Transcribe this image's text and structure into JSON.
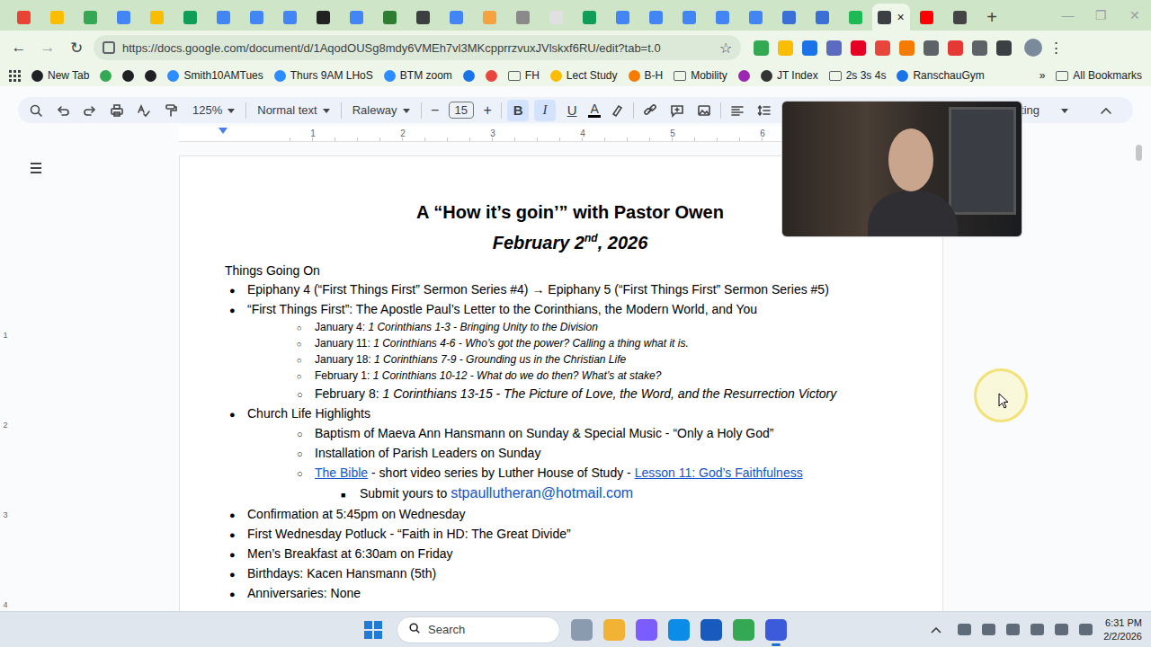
{
  "tab_strip": {
    "tabs": [
      {
        "color": "#ea4335",
        "selected": false
      },
      {
        "color": "#fbbc04",
        "selected": false
      },
      {
        "color": "#34a853",
        "selected": false
      },
      {
        "color": "#4285f4",
        "selected": false
      },
      {
        "color": "#fbbc04",
        "selected": false
      },
      {
        "color": "#0f9d58",
        "selected": false
      },
      {
        "color": "#4285f4",
        "selected": false
      },
      {
        "color": "#4285f4",
        "selected": false
      },
      {
        "color": "#4285f4",
        "selected": false
      },
      {
        "color": "#222222",
        "selected": false
      },
      {
        "color": "#4285f4",
        "selected": false
      },
      {
        "color": "#2e7d32",
        "selected": false
      },
      {
        "color": "#3c4043",
        "selected": false
      },
      {
        "color": "#4285f4",
        "selected": false
      },
      {
        "color": "#f4a340",
        "selected": false
      },
      {
        "color": "#8a8a8a",
        "selected": false
      },
      {
        "color": "#e0e0e0",
        "selected": false
      },
      {
        "color": "#0f9d58",
        "selected": false
      },
      {
        "color": "#4285f4",
        "selected": false
      },
      {
        "color": "#4285f4",
        "selected": false
      },
      {
        "color": "#4285f4",
        "selected": false
      },
      {
        "color": "#4285f4",
        "selected": false
      },
      {
        "color": "#4285f4",
        "selected": false
      },
      {
        "color": "#3b6fd8",
        "selected": false
      },
      {
        "color": "#3b6fd8",
        "selected": false
      },
      {
        "color": "#1db954",
        "selected": false
      },
      {
        "color": "#3c4043",
        "selected": true
      },
      {
        "color": "#ff0000",
        "selected": false
      },
      {
        "color": "#444444",
        "selected": false
      }
    ],
    "close_glyph": "×",
    "new_tab": "+",
    "window_controls": [
      "—",
      "❐",
      "✕"
    ]
  },
  "toolbar": {
    "back": "←",
    "forward": "→",
    "reload": "↻",
    "url": "https://docs.google.com/document/d/1AqodOUSg8mdy6VMEh7vl3MKcpprrzvuxJVlskxf6RU/edit?tab=t.0",
    "star": "☆",
    "menu": "⋮",
    "extensions": [
      {
        "color": "#34a853"
      },
      {
        "color": "#fbbc04"
      },
      {
        "color": "#1a73e8"
      },
      {
        "color": "#5c6bc0"
      },
      {
        "color": "#e60023"
      },
      {
        "color": "#e8453c"
      },
      {
        "color": "#f57c00"
      },
      {
        "color": "#5f6368"
      },
      {
        "color": "#e53935"
      },
      {
        "color": "#5f6368"
      },
      {
        "color": "#3c4043"
      }
    ]
  },
  "bookmarks": {
    "items": [
      {
        "label": "New Tab",
        "kind": "site",
        "color": "#202124"
      },
      {
        "kind": "site",
        "color": "#34a853"
      },
      {
        "kind": "site",
        "color": "#202124"
      },
      {
        "kind": "site",
        "color": "#202124"
      },
      {
        "label": "Smith10AMTues",
        "kind": "site",
        "color": "#2d8cff"
      },
      {
        "label": "Thurs 9AM LHoS",
        "kind": "site",
        "color": "#2d8cff"
      },
      {
        "label": "BTM zoom",
        "kind": "site",
        "color": "#2d8cff"
      },
      {
        "kind": "site",
        "color": "#1a73e8"
      },
      {
        "kind": "site",
        "color": "#e8453c"
      },
      {
        "label": "FH",
        "kind": "folder",
        "color": "#5f6368"
      },
      {
        "label": "Lect Study",
        "kind": "site",
        "color": "#fbbc04"
      },
      {
        "label": "B-H",
        "kind": "site",
        "color": "#f57c00"
      },
      {
        "label": "Mobility",
        "kind": "folder",
        "color": "#5f6368"
      },
      {
        "kind": "site",
        "color": "#9c27b0"
      },
      {
        "label": "JT Index",
        "kind": "site",
        "color": "#333333"
      },
      {
        "label": "2s 3s 4s",
        "kind": "folder",
        "color": "#5f6368"
      },
      {
        "label": "RanschauGym",
        "kind": "site",
        "color": "#1a73e8"
      }
    ],
    "more": "»",
    "all": "All Bookmarks"
  },
  "docs_toolbar": {
    "zoom": "125%",
    "style": "Normal text",
    "font": "Raleway",
    "minus": "−",
    "size": "15",
    "plus": "+",
    "format": [
      {
        "label": "B",
        "selected": true
      },
      {
        "label": "I",
        "selected": true
      },
      {
        "label": "U",
        "selected": false
      }
    ],
    "text_color": "A",
    "mode": "diting"
  },
  "ruler": [
    "1",
    "2",
    "3",
    "4",
    "5",
    "6"
  ],
  "vertical_ruler": [
    "1",
    "2",
    "3",
    "4"
  ],
  "document": {
    "title": "A “How it’s goin’” with Pastor Owen",
    "date": {
      "main": "February 2",
      "sup": "nd",
      "rest": ", 2026"
    },
    "section": "Things Going On",
    "items": [
      {
        "level": 1,
        "size": "normal",
        "bullet": "●",
        "segments": [
          {
            "text": "Epiphany 4 (“First Things First” Sermon Series #4) → Epiphany 5 (“First Things First” Sermon Series #5)",
            "kind": "plain"
          }
        ]
      },
      {
        "level": 1,
        "size": "normal",
        "bullet": "●",
        "segments": [
          {
            "text": "“First Things First”: The Apostle Paul’s Letter to the Corinthians, the Modern World, and You",
            "kind": "plain"
          }
        ]
      },
      {
        "level": 2,
        "size": "small",
        "bullet": "○",
        "segments": [
          {
            "text": "January 4: ",
            "kind": "plain"
          },
          {
            "text": "1 Corinthians 1-3 - Bringing Unity to the Division",
            "kind": "italic"
          }
        ]
      },
      {
        "level": 2,
        "size": "small",
        "bullet": "○",
        "segments": [
          {
            "text": "January 11: ",
            "kind": "plain"
          },
          {
            "text": "1 Corinthians 4-6 - Who’s got the power? Calling a thing what it is.",
            "kind": "italic"
          }
        ]
      },
      {
        "level": 2,
        "size": "small",
        "bullet": "○",
        "segments": [
          {
            "text": "January 18: ",
            "kind": "plain"
          },
          {
            "text": "1 Corinthians 7-9 - Grounding us in the Christian Life",
            "kind": "italic"
          }
        ]
      },
      {
        "level": 2,
        "size": "small",
        "bullet": "○",
        "segments": [
          {
            "text": "February 1: ",
            "kind": "plain"
          },
          {
            "text": "1 Corinthians 10-12 - What do we do then? What’s at stake?",
            "kind": "italic"
          }
        ]
      },
      {
        "level": 2,
        "size": "normal",
        "bullet": "○",
        "segments": [
          {
            "text": "February 8: ",
            "kind": "plain"
          },
          {
            "text": "1 Corinthians 13-15 - The Picture of Love, the Word, and the Resurrection Victory",
            "kind": "italic"
          }
        ]
      },
      {
        "level": 1,
        "size": "normal",
        "bullet": "●",
        "segments": [
          {
            "text": "Church Life Highlights",
            "kind": "plain"
          }
        ]
      },
      {
        "level": 2,
        "size": "normal",
        "bullet": "○",
        "segments": [
          {
            "text": "Baptism of Maeva Ann Hansmann on Sunday & Special Music - “Only a Holy God”",
            "kind": "plain"
          }
        ]
      },
      {
        "level": 2,
        "size": "normal",
        "bullet": "○",
        "segments": [
          {
            "text": "Installation of Parish Leaders on Sunday",
            "kind": "plain"
          }
        ]
      },
      {
        "level": 2,
        "size": "normal",
        "bullet": "○",
        "segments": [
          {
            "text": "The Bible",
            "kind": "link"
          },
          {
            "text": " - short video series by Luther House of Study - ",
            "kind": "plain"
          },
          {
            "text": "Lesson 11: God’s Faithfulness",
            "kind": "link"
          }
        ]
      },
      {
        "level": 3,
        "size": "normal",
        "bullet": "■",
        "segments": [
          {
            "text": "Submit yours to ",
            "kind": "plain"
          },
          {
            "text": "stpaullutheran@hotmail.com",
            "kind": "email"
          }
        ]
      },
      {
        "level": 1,
        "size": "normal",
        "bullet": "●",
        "segments": [
          {
            "text": "Confirmation at 5:45pm on Wednesday",
            "kind": "plain"
          }
        ]
      },
      {
        "level": 1,
        "size": "normal",
        "bullet": "●",
        "segments": [
          {
            "text": "First Wednesday Potluck - “Faith in HD: The Great Divide”",
            "kind": "plain"
          }
        ]
      },
      {
        "level": 1,
        "size": "normal",
        "bullet": "●",
        "segments": [
          {
            "text": "Men’s Breakfast at 6:30am on Friday",
            "kind": "plain"
          }
        ]
      },
      {
        "level": 1,
        "size": "normal",
        "bullet": "●",
        "segments": [
          {
            "text": "Birthdays: Kacen Hansmann (5th)",
            "kind": "plain"
          }
        ]
      },
      {
        "level": 1,
        "size": "normal",
        "bullet": "●",
        "segments": [
          {
            "text": "Anniversaries: None",
            "kind": "plain"
          }
        ]
      }
    ]
  },
  "taskbar": {
    "search": "Search",
    "time": "6:31 PM",
    "date": "2/2/2026",
    "apps": [
      {
        "color": "#8a9bb0",
        "selected": false
      },
      {
        "color": "#f2b233",
        "selected": false
      },
      {
        "color": "#7b5cff",
        "selected": false
      },
      {
        "color": "#0c8ce9",
        "selected": false
      },
      {
        "color": "#185abd",
        "selected": false
      },
      {
        "color": "#34a853",
        "selected": false
      },
      {
        "color": "#3b5bdb",
        "selected": true
      }
    ]
  }
}
